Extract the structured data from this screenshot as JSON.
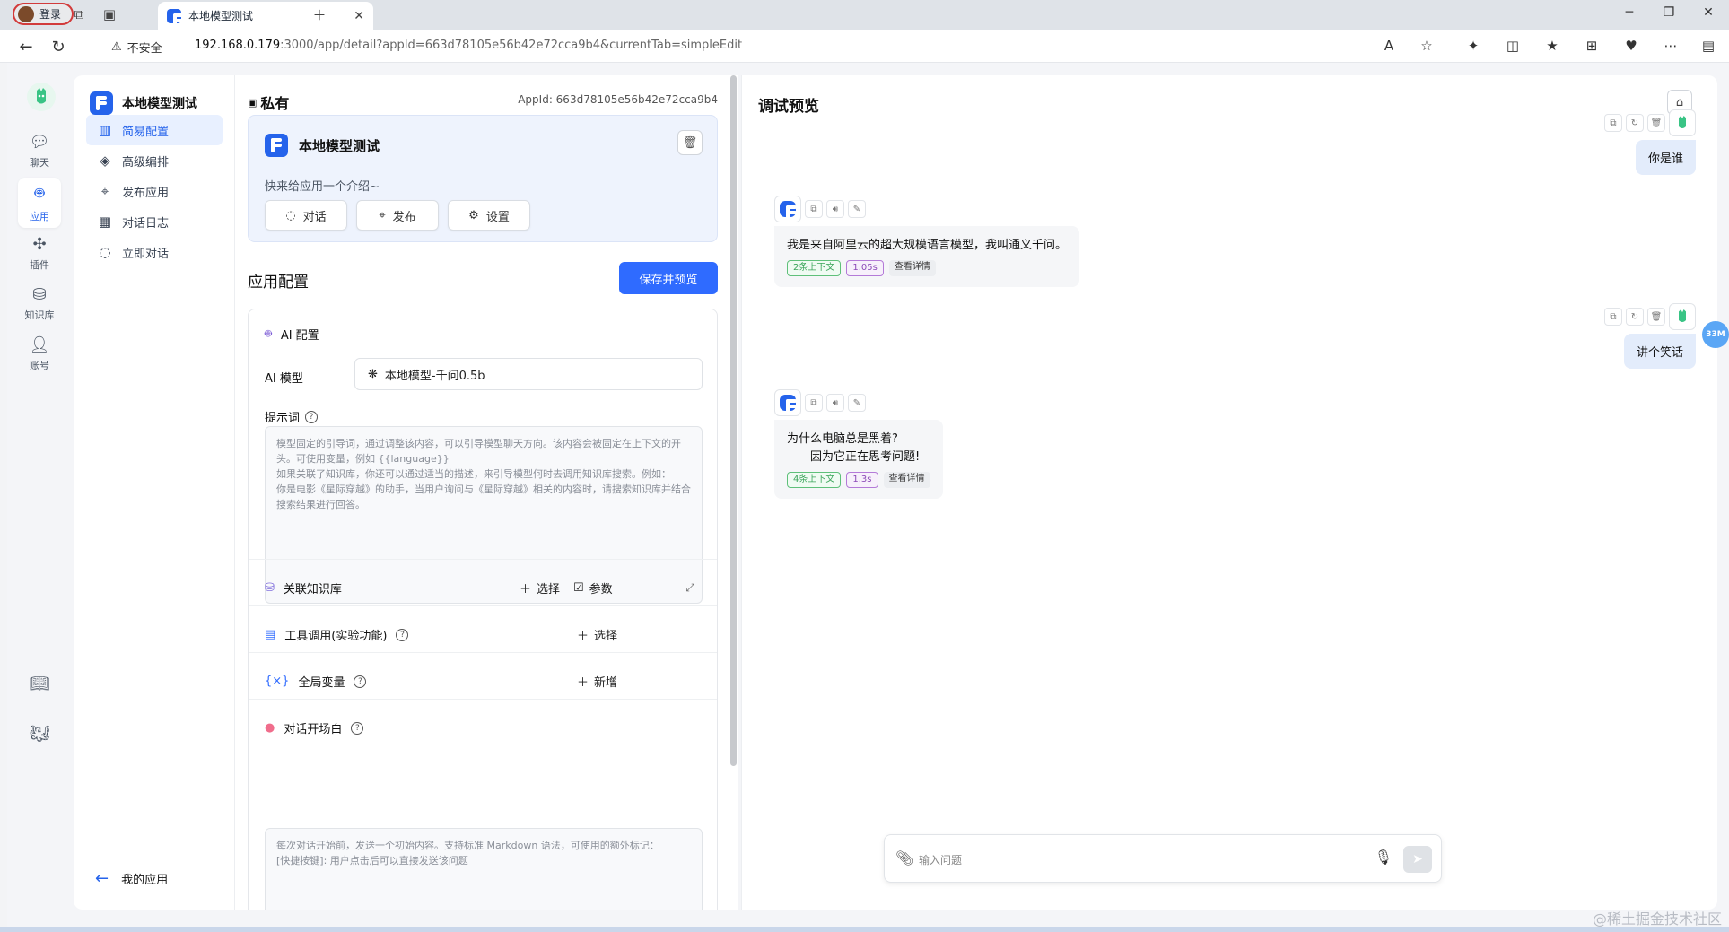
{
  "browser": {
    "login_label": "登录",
    "tab_title": "本地模型测试",
    "insecure_label": "不安全",
    "url_host": "192.168.0.179",
    "url_path": ":3000/app/detail?appId=663d78105e56b42e72cca9b4&currentTab=simpleEdit"
  },
  "leftnav": {
    "items": [
      {
        "label": "聊天",
        "icon": "chat-icon"
      },
      {
        "label": "应用",
        "icon": "app-robot-icon"
      },
      {
        "label": "插件",
        "icon": "puzzle-icon"
      },
      {
        "label": "知识库",
        "icon": "database-icon"
      },
      {
        "label": "账号",
        "icon": "user-icon"
      }
    ]
  },
  "app_menu": {
    "app_name": "本地模型测试",
    "items": [
      {
        "label": "简易配置",
        "icon": "chart-icon"
      },
      {
        "label": "高级编排",
        "icon": "layers-icon"
      },
      {
        "label": "发布应用",
        "icon": "share-icon"
      },
      {
        "label": "对话日志",
        "icon": "log-icon"
      },
      {
        "label": "立即对话",
        "icon": "chat-icon"
      }
    ],
    "back_label": "我的应用"
  },
  "config": {
    "visibility": "私有",
    "app_id": "AppId: 663d78105e56b42e72cca9b4",
    "app_title": "本地模型测试",
    "app_desc": "快来给应用一个介绍~",
    "btn_chat": "对话",
    "btn_publish": "发布",
    "btn_settings": "设置",
    "section_title": "应用配置",
    "save_btn": "保存并预览",
    "ai_config": "AI 配置",
    "ai_model_label": "AI 模型",
    "ai_model_value": "本地模型-千问0.5b",
    "prompt_label": "提示词",
    "prompt_placeholder": "模型固定的引导词，通过调整该内容，可以引导模型聊天方向。该内容会被固定在上下文的开头。可使用变量，例如 {{language}}\n如果关联了知识库，你还可以通过适当的描述，来引导模型何时去调用知识库搜索。例如：\n你是电影《星际穿越》的助手，当用户询问与《星际穿越》相关的内容时，请搜索知识库并结合搜索结果进行回答。",
    "kb_label": "关联知识库",
    "kb_select": "选择",
    "kb_params": "参数",
    "tools_label": "工具调用(实验功能)",
    "tools_select": "选择",
    "vars_label": "全局变量",
    "vars_add": "新增",
    "welcome_label": "对话开场白",
    "welcome_placeholder": "每次对话开始前，发送一个初始内容。支持标准 Markdown 语法，可使用的额外标记：\n[快捷按键]: 用户点击后可以直接发送该问题"
  },
  "debug": {
    "title": "调试预览",
    "messages": [
      {
        "role": "user",
        "text": "你是谁"
      },
      {
        "role": "bot",
        "text": "我是来自阿里云的超大规模语言模型，我叫通义千问。",
        "ctx": "2条上下文",
        "time": "1.05s",
        "detail": "查看详情"
      },
      {
        "role": "user",
        "text": "讲个笑话"
      },
      {
        "role": "bot",
        "line1": "为什么电脑总是黑着?",
        "line2": "——因为它正在思考问题!",
        "ctx": "4条上下文",
        "time": "1.3s",
        "detail": "查看详情"
      }
    ],
    "input_placeholder": "输入问题"
  },
  "float_badge": "33M",
  "watermark": "@稀土掘金技术社区",
  "colors": {
    "accent": "#2f6bff",
    "active_bg": "#e8f0ff"
  }
}
